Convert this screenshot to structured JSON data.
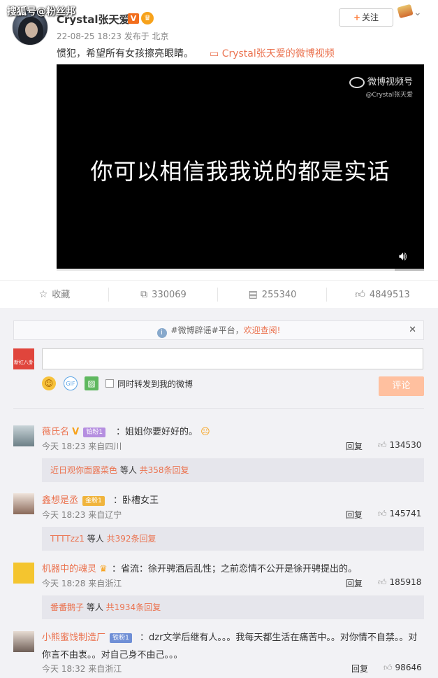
{
  "watermark": "搜狐号@粉丝邦",
  "post": {
    "author": "Crystal张天爱",
    "verified_badge": "V",
    "timestamp": "22-08-25 18:23",
    "source": "发布于 北京",
    "text": "惯犯，希望所有女孩擦亮眼睛。",
    "video_link": "Crystal张天爱的微博视频",
    "follow_label": "关注",
    "video": {
      "caption": "你可以相信我我说的都是实话",
      "logo_text": "微博视频号",
      "logo_handle": "@Crystal张天爱",
      "progress": 0.08
    },
    "actions": {
      "favorite_label": "收藏",
      "repost_count": "330069",
      "comment_count": "255340",
      "like_count": "4849513"
    }
  },
  "comment_box": {
    "notice_prefix": "#微博辟谣#平台，",
    "notice_link": "欢迎查阅!",
    "repost_label": "同时转发到我的微博",
    "submit_label": "评论",
    "my_avatar_text": "新红八卦"
  },
  "comments": [
    {
      "name": "薇氏名",
      "has_v": true,
      "badge": "铂粉1",
      "text": "：姐姐你要好好的。",
      "time": "今天 18:23 来自四川",
      "reply_label": "回复",
      "likes": "134530",
      "sub_name": "近日观你面露菜色",
      "sub_mid": " 等人 ",
      "sub_count": "共358条回复"
    },
    {
      "name": "鑫想是丞",
      "has_v": false,
      "badge": "金粉1",
      "text": "：卧槽女王",
      "time": "今天 18:23 来自辽宁",
      "reply_label": "回复",
      "likes": "145741",
      "sub_name": "TTTTzz1",
      "sub_mid": " 等人 ",
      "sub_count": "共392条回复"
    },
    {
      "name": "机器中的魂灵",
      "has_v": false,
      "badge": "",
      "text": "：省流：徐开骋酒后乱性；之前恋情不公开是徐开骋提出的。",
      "time": "今天 18:28 来自浙江",
      "reply_label": "回复",
      "likes": "185918",
      "sub_name": "番番鹅子",
      "sub_mid": " 等人 ",
      "sub_count": "共1934条回复"
    },
    {
      "name": "小熊蜜饯制造厂",
      "has_v": false,
      "badge": "铁粉1",
      "text_line1": "：dzr文学后继有人。。。我每天都生活在痛苦中。。对你情不自禁。。对",
      "text_line2": "你言不由衷。。对自己身不由己。。。",
      "time": "今天 18:32 来自浙江",
      "reply_label": "回复",
      "likes": "98646"
    }
  ],
  "colors": {
    "accent": "#eb7350",
    "video_bg": "#000000",
    "comment_bg": "#f2f2f5",
    "submit_disabled": "#ffc09f"
  }
}
